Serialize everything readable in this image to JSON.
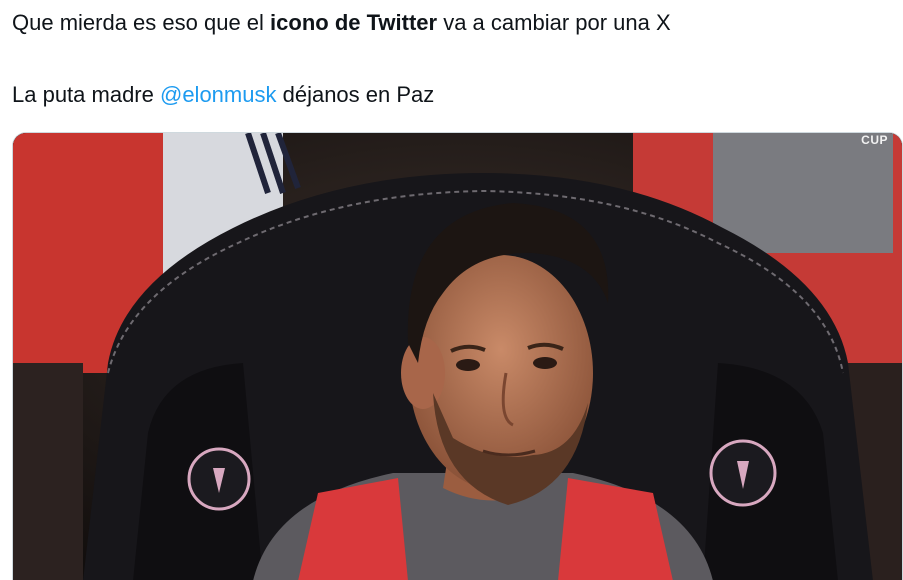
{
  "tweet": {
    "line1": {
      "before": "Que mierda es eso que el ",
      "bold": "icono de Twitter",
      "after": " va a cambiar por una X"
    },
    "line2": {
      "before": "La puta madre ",
      "mention": "@elonmusk",
      "after": " déjanos en Paz"
    }
  },
  "media": {
    "watermark": "CUP",
    "colors": {
      "accent_link": "#1d9bf0",
      "bib_red": "#d9393b",
      "chair_black": "#17161a",
      "badge_pink": "#d8a8c0"
    }
  }
}
